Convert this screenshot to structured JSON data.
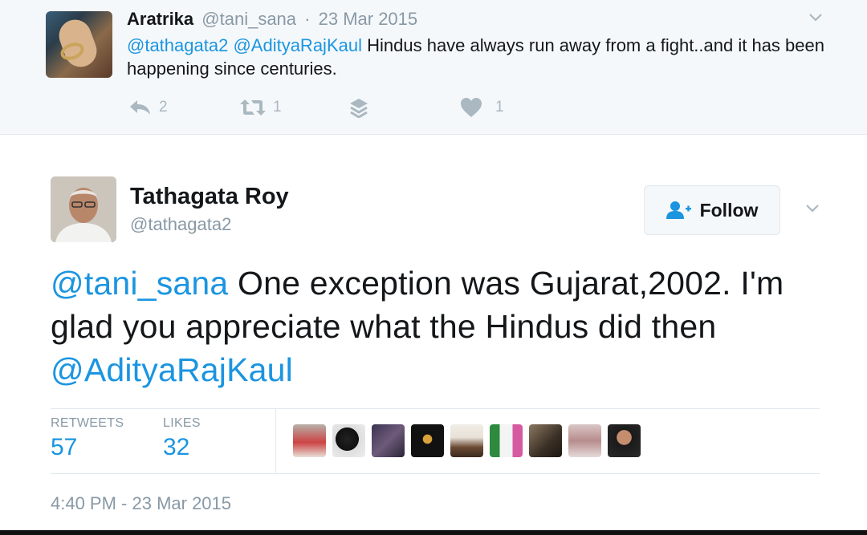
{
  "reply": {
    "name": "Aratrika",
    "handle": "@tani_sana",
    "separator": "·",
    "date": "23 Mar 2015",
    "mention1": "@tathagata2",
    "mention2": "@AdityaRajKaul",
    "text": "Hindus have always run away from a fight..and it has been happening since centuries.",
    "actions": {
      "reply_count": "2",
      "retweet_count": "1",
      "like_count": "1"
    }
  },
  "tweet": {
    "name": "Tathagata Roy",
    "handle": "@tathagata2",
    "follow_label": "Follow",
    "mention_lead": "@tani_sana",
    "text": "One exception was Gujarat,2002. I'm glad you appreciate what the Hindus did then",
    "mention_trail": "@AdityaRajKaul",
    "stats": {
      "retweets_label": "RETWEETS",
      "retweets_value": "57",
      "likes_label": "LIKES",
      "likes_value": "32"
    },
    "timestamp": "4:40 PM - 23 Mar 2015"
  },
  "colors": {
    "link": "#1b95e0",
    "muted": "#8899a6",
    "action": "#aab8c2",
    "reply_bg": "#f5f8fa"
  },
  "icons": [
    "reply-icon",
    "retweet-icon",
    "stack-icon",
    "heart-icon",
    "chevron-down-icon",
    "add-user-icon"
  ]
}
